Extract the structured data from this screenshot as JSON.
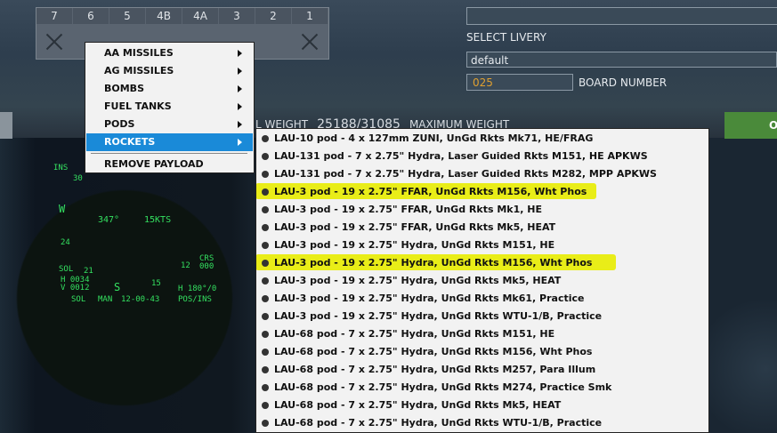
{
  "stations": [
    "7",
    "6",
    "5",
    "4B",
    "4A",
    "3",
    "2",
    "1"
  ],
  "livery": {
    "label": "SELECT LIVERY",
    "value": "default"
  },
  "board": {
    "value": "025",
    "label": "BOARD NUMBER"
  },
  "weight": {
    "label_left": "L WEIGHT",
    "value": "25188/31085",
    "label_right": "MAXIMUM WEIGHT"
  },
  "ok_label": "O",
  "hud": {
    "ins": "INS",
    "n30": "30",
    "w": "W",
    "heading": "347°",
    "speed": "15KTS",
    "n24": "24",
    "s": "S",
    "n12": "12",
    "n21": "21",
    "n15": "15",
    "crs": "CRS",
    "n000": "000",
    "h_left": "H 0034",
    "v_left": "V 0012",
    "h_right": "H 180°/0",
    "sol": "SOL",
    "man": "MAN",
    "time": "12-00-43",
    "pos": "POS/INS"
  },
  "menu": {
    "items": [
      {
        "label": "AA MISSILES"
      },
      {
        "label": "AG MISSILES"
      },
      {
        "label": "BOMBS"
      },
      {
        "label": "FUEL TANKS"
      },
      {
        "label": "PODS"
      },
      {
        "label": "ROCKETS"
      }
    ],
    "remove_label": "REMOVE PAYLOAD"
  },
  "submenu": {
    "items": [
      "LAU-10 pod - 4 x 127mm ZUNI, UnGd Rkts Mk71, HE/FRAG",
      "LAU-131 pod - 7 x 2.75\" Hydra, Laser Guided Rkts M151, HE APKWS",
      "LAU-131 pod - 7 x 2.75\" Hydra, Laser Guided Rkts M282, MPP APKWS",
      "LAU-3 pod - 19 x 2.75\" FFAR, UnGd Rkts M156, Wht Phos",
      "LAU-3 pod - 19 x 2.75\" FFAR, UnGd Rkts Mk1, HE",
      "LAU-3 pod - 19 x 2.75\" FFAR, UnGd Rkts Mk5, HEAT",
      "LAU-3 pod - 19 x 2.75\" Hydra, UnGd Rkts M151, HE",
      "LAU-3 pod - 19 x 2.75\" Hydra, UnGd Rkts M156, Wht Phos",
      "LAU-3 pod - 19 x 2.75\" Hydra, UnGd Rkts Mk5, HEAT",
      "LAU-3 pod - 19 x 2.75\" Hydra, UnGd Rkts Mk61, Practice",
      "LAU-3 pod - 19 x 2.75\" Hydra, UnGd Rkts WTU-1/B, Practice",
      "LAU-68 pod - 7 x 2.75\" Hydra, UnGd Rkts M151, HE",
      "LAU-68 pod - 7 x 2.75\" Hydra, UnGd Rkts M156, Wht Phos",
      "LAU-68 pod - 7 x 2.75\" Hydra, UnGd Rkts M257, Para Illum",
      "LAU-68 pod - 7 x 2.75\" Hydra, UnGd Rkts M274, Practice Smk",
      "LAU-68 pod - 7 x 2.75\" Hydra, UnGd Rkts Mk5, HEAT",
      "LAU-68 pod - 7 x 2.75\" Hydra, UnGd Rkts WTU-1/B, Practice"
    ]
  },
  "colors": {
    "highlight": "#e8ec00",
    "menu_selected": "#1a8ad8",
    "hud_green": "#34e060",
    "board_text": "#e0a030"
  }
}
